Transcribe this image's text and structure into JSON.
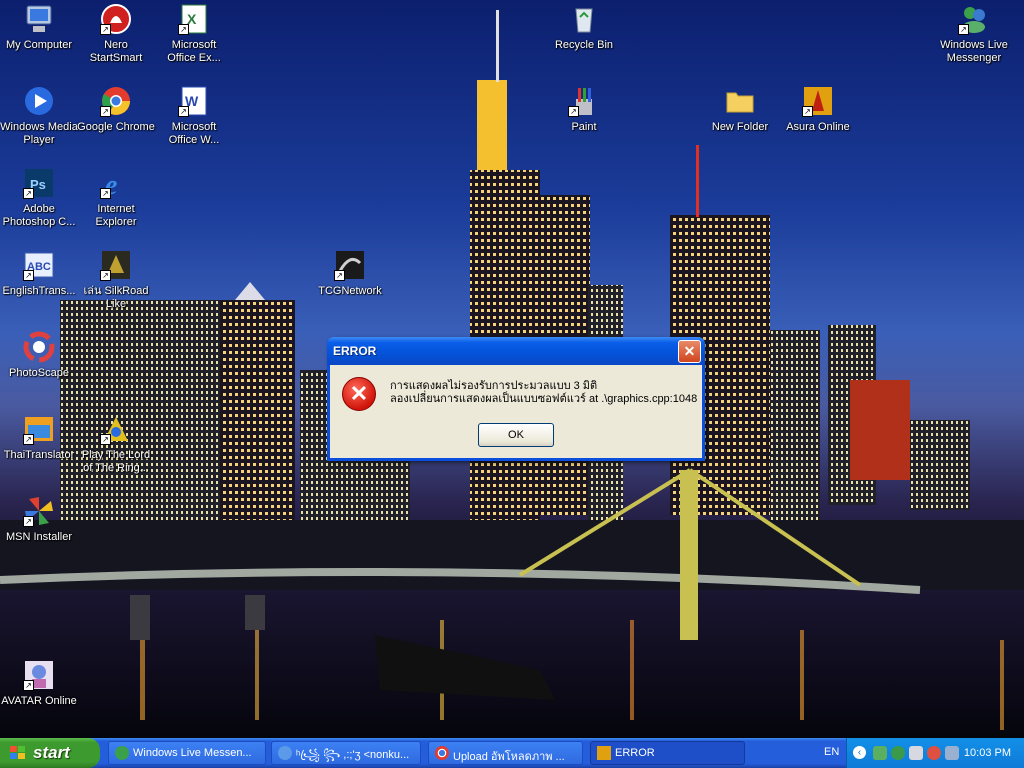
{
  "desktop_icons": [
    {
      "label": "My Computer",
      "icon": "computer-icon",
      "shortcut": false
    },
    {
      "label": "Nero\nStartSmart",
      "icon": "nero-icon",
      "shortcut": true
    },
    {
      "label": "Microsoft\nOffice Ex...",
      "icon": "excel-icon",
      "shortcut": true
    },
    {
      "label": "Recycle Bin",
      "icon": "recycle-bin-icon",
      "shortcut": false
    },
    {
      "label": "Windows Live\nMessenger",
      "icon": "messenger-icon",
      "shortcut": true
    },
    {
      "label": "Windows Media\nPlayer",
      "icon": "media-player-icon",
      "shortcut": false
    },
    {
      "label": "Google Chrome",
      "icon": "chrome-icon",
      "shortcut": true
    },
    {
      "label": "Microsoft\nOffice W...",
      "icon": "word-icon",
      "shortcut": true
    },
    {
      "label": "Paint",
      "icon": "paint-icon",
      "shortcut": true
    },
    {
      "label": "New Folder",
      "icon": "folder-icon",
      "shortcut": false
    },
    {
      "label": "Asura Online",
      "icon": "asura-icon",
      "shortcut": true
    },
    {
      "label": "Adobe\nPhotoshop C...",
      "icon": "photoshop-icon",
      "shortcut": true
    },
    {
      "label": "Internet\nExplorer",
      "icon": "ie-icon",
      "shortcut": true
    },
    {
      "label": "EnglishTrans...",
      "icon": "abc-icon",
      "shortcut": true
    },
    {
      "label": "เล่น SilkRoad\nLike",
      "icon": "silkroad-icon",
      "shortcut": true
    },
    {
      "label": "TCGNetwork",
      "icon": "tcg-icon",
      "shortcut": true
    },
    {
      "label": "PhotoScape",
      "icon": "photoscape-icon",
      "shortcut": false
    },
    {
      "label": "ThaiTranslator",
      "icon": "thaitranslator-icon",
      "shortcut": true
    },
    {
      "label": "Play The Lord\nof The Ring...",
      "icon": "lotr-icon",
      "shortcut": true
    },
    {
      "label": "MSN Installer",
      "icon": "msn-icon",
      "shortcut": true
    },
    {
      "label": "AVATAR Online",
      "icon": "avatar-icon",
      "shortcut": true
    }
  ],
  "dialog": {
    "title": "ERROR",
    "close_label": "✕",
    "icon": "error-icon",
    "message_line1": "การแสดงผลไม่รองรับการประมวลแบบ 3 มิติ",
    "message_line2": "ลองเปลี่ยนการแสดงผลเป็นแบบซอฟต์แวร์ at .\\graphics.cpp:1048",
    "ok_label": "OK"
  },
  "taskbar": {
    "start_label": "start",
    "buttons": [
      {
        "label": "Windows Live Messen...",
        "icon": "messenger-icon"
      },
      {
        "label": "ʰ꧁ꦿ ꧂ ,:;'ʒ <nonku...",
        "icon": "msn-chat-icon"
      },
      {
        "label": "Upload อัพโหลดภาพ ...",
        "icon": "chrome-icon"
      },
      {
        "label": "ERROR",
        "icon": "app-icon",
        "active": true
      }
    ],
    "language": "EN",
    "clock": "10:03 PM"
  },
  "colors": {
    "taskbar_blue": "#245edb",
    "start_green": "#3c9a2e",
    "dialog_title_blue": "#0453d9",
    "dialog_body": "#ece9d8",
    "error_red": "#d0150a"
  }
}
